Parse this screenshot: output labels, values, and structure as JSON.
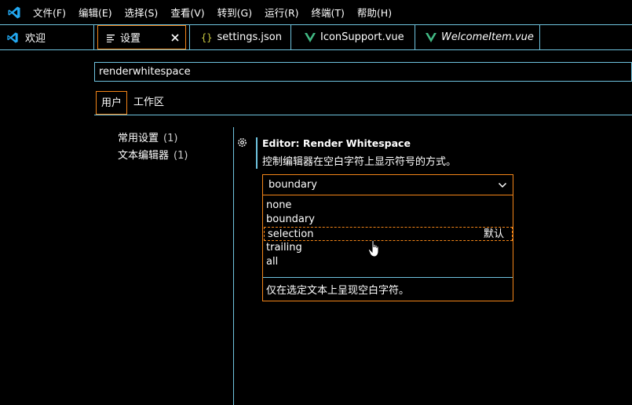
{
  "menubar": {
    "logo_icon": "vscode-logo-icon",
    "items": [
      "文件(F)",
      "编辑(E)",
      "选择(S)",
      "查看(V)",
      "转到(G)",
      "运行(R)",
      "终端(T)",
      "帮助(H)"
    ]
  },
  "tabs": [
    {
      "label": "欢迎",
      "icon": "vscode-logo-icon",
      "active": false,
      "italic": false
    },
    {
      "label": "设置",
      "icon": "settings-lines-icon",
      "active": true,
      "italic": false
    },
    {
      "label": "settings.json",
      "icon": "json-braces-icon",
      "active": false,
      "italic": false
    },
    {
      "label": "IconSupport.vue",
      "icon": "vue-icon",
      "active": false,
      "italic": false
    },
    {
      "label": "WelcomeItem.vue",
      "icon": "vue-icon",
      "active": false,
      "italic": true
    }
  ],
  "search": {
    "value": "renderwhitespace"
  },
  "scope_tabs": [
    "用户",
    "工作区"
  ],
  "toc": [
    {
      "label": "常用设置",
      "count": "(1)"
    },
    {
      "label": "文本编辑器",
      "count": "(1)"
    }
  ],
  "setting": {
    "title": "Editor: Render Whitespace",
    "description": "控制编辑器在空白字符上显示符号的方式。",
    "current_value": "boundary",
    "options": [
      "none",
      "boundary",
      "selection",
      "trailing",
      "all"
    ],
    "highlighted_option": "selection",
    "default_badge": "默认",
    "option_hint": "仅在选定文本上呈现空白字符。"
  },
  "colors": {
    "focus_border": "#f38518",
    "contrast_border": "#6fc3df",
    "vue_green": "#41b883",
    "json_yellow": "#cbcb41",
    "vscode_blue": "#23a9f2"
  }
}
